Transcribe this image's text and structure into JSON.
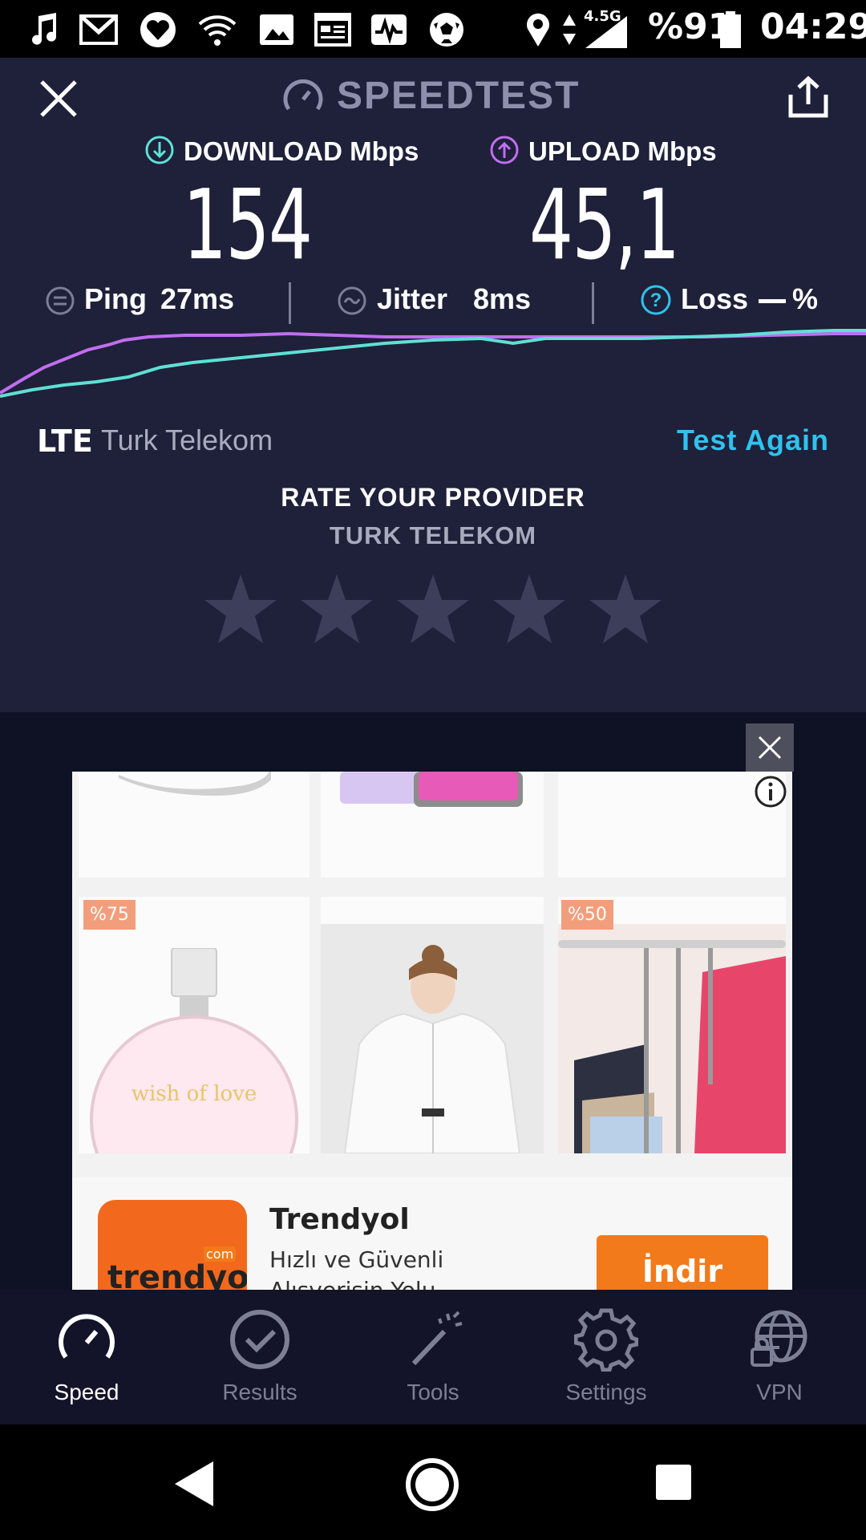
{
  "status_bar": {
    "network": "4.5G",
    "battery": "%91",
    "time": "04:29"
  },
  "header": {
    "title": "SPEEDTEST"
  },
  "results": {
    "download_label": "DOWNLOAD Mbps",
    "download_value": "154",
    "upload_label": "UPLOAD Mbps",
    "upload_value": "45,1",
    "ping_label": "Ping",
    "ping_value": "27ms",
    "jitter_label": "Jitter",
    "jitter_value": "8ms",
    "loss_label": "Loss",
    "loss_value": "%"
  },
  "colors": {
    "download": "#5ee0d6",
    "upload": "#c06ef0",
    "accent": "#2fc2ee"
  },
  "provider": {
    "tech": "LTE",
    "name": "Turk Telekom",
    "test_again": "Test Again",
    "rate_title": "RATE YOUR PROVIDER",
    "rate_subtitle": "TURK TELEKOM",
    "stars": 5
  },
  "ad": {
    "badge_left": "%75",
    "badge_right": "%50",
    "perfume_text": "wish of love",
    "brand": "Trendyol",
    "description": "Hızlı ve Güvenli Alışverişin Yolu",
    "cta": "İndir",
    "logo_text": "trendyol",
    "logo_sup": "com"
  },
  "nav": {
    "items": [
      {
        "label": "Speed",
        "icon": "speedometer-icon",
        "active": true
      },
      {
        "label": "Results",
        "icon": "check-circle-icon",
        "active": false
      },
      {
        "label": "Tools",
        "icon": "magic-wand-icon",
        "active": false
      },
      {
        "label": "Settings",
        "icon": "gear-icon",
        "active": false
      },
      {
        "label": "VPN",
        "icon": "globe-lock-icon",
        "active": false
      }
    ]
  }
}
